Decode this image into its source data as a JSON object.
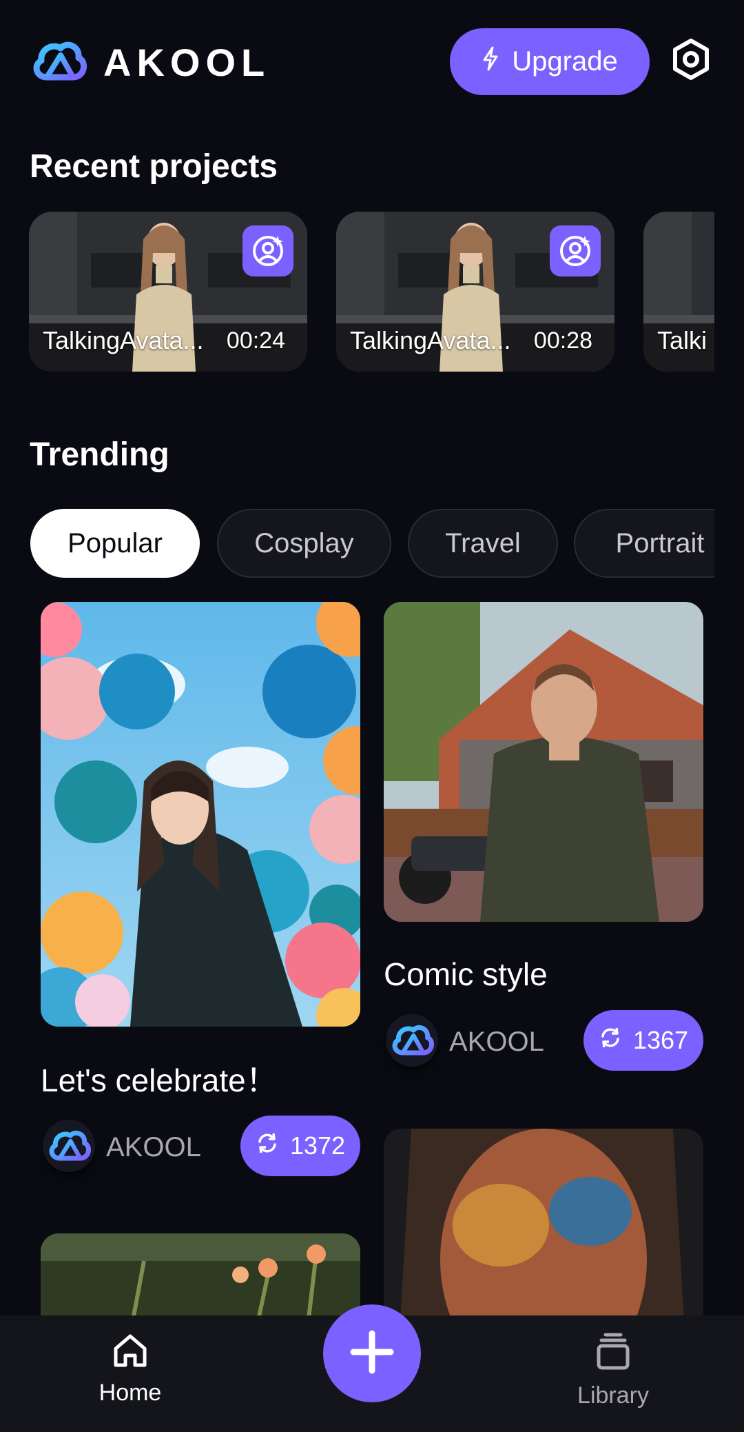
{
  "header": {
    "logo_text": "AKOOL",
    "upgrade_label": "Upgrade",
    "icons": {
      "logo": "akool-cloud-logo",
      "upgrade": "lightning-icon",
      "settings": "hexagon-settings-icon"
    }
  },
  "recent": {
    "title": "Recent projects",
    "projects": [
      {
        "name": "TalkingAvata...",
        "duration": "00:24"
      },
      {
        "name": "TalkingAvata...",
        "duration": "00:28"
      },
      {
        "name": "Talki",
        "duration": ""
      }
    ]
  },
  "trending": {
    "title": "Trending",
    "chips": [
      "Popular",
      "Cosplay",
      "Travel",
      "Portrait"
    ],
    "selected_chip": "Popular",
    "cards": [
      {
        "title": "Let's celebrate！",
        "author": "AKOOL",
        "count": "1372"
      },
      {
        "title": "Comic style",
        "author": "AKOOL",
        "count": "1367"
      }
    ]
  },
  "nav": {
    "home_label": "Home",
    "library_label": "Library",
    "icons": {
      "home": "home-icon",
      "add": "plus-icon",
      "library": "stack-icon"
    }
  },
  "colors": {
    "accent": "#7b61ff",
    "background": "#0a0b12",
    "nav_bg": "#14151b"
  }
}
